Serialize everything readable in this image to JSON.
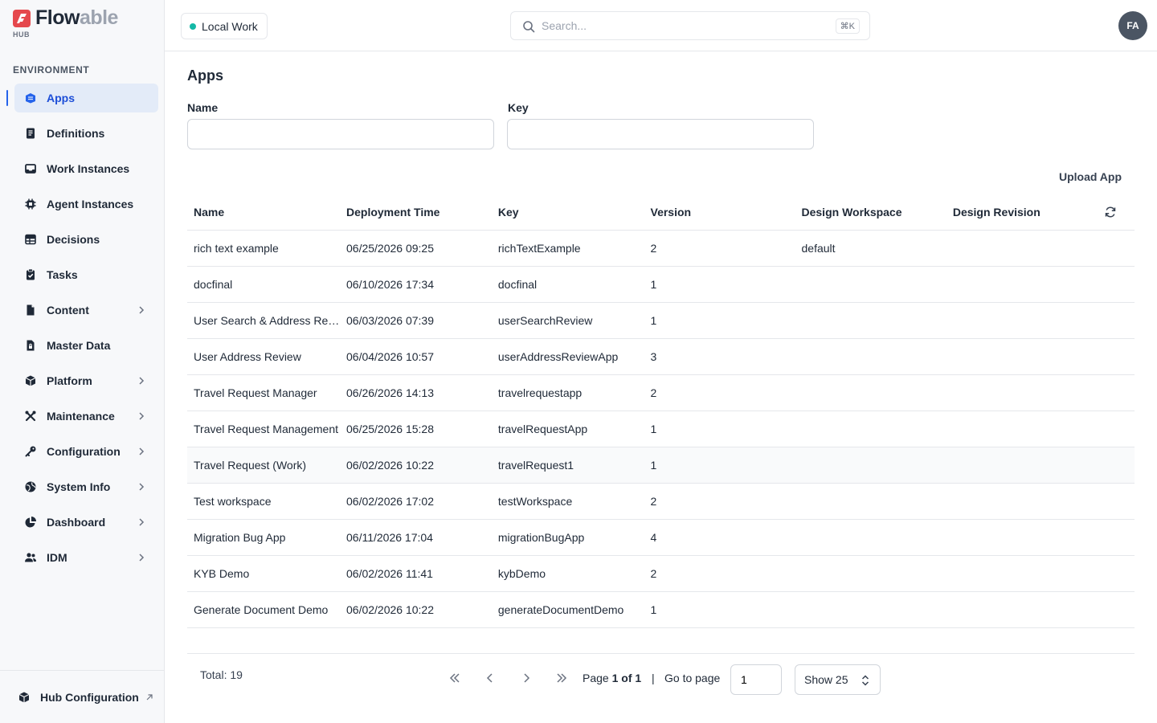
{
  "brand": {
    "name_part1": "Flow",
    "name_part2": "able",
    "sub": "HUB"
  },
  "sidebar": {
    "section_label": "ENVIRONMENT",
    "items": [
      {
        "label": "Apps",
        "icon": "apps-icon",
        "active": true,
        "chevron": false
      },
      {
        "label": "Definitions",
        "icon": "book-icon",
        "chevron": false
      },
      {
        "label": "Work Instances",
        "icon": "inbox-icon",
        "chevron": false
      },
      {
        "label": "Agent Instances",
        "icon": "chip-icon",
        "chevron": false
      },
      {
        "label": "Decisions",
        "icon": "table-icon",
        "chevron": false
      },
      {
        "label": "Tasks",
        "icon": "clipboard-check-icon",
        "chevron": false
      },
      {
        "label": "Content",
        "icon": "file-icon",
        "chevron": true
      },
      {
        "label": "Master Data",
        "icon": "file-lock-icon",
        "chevron": false
      },
      {
        "label": "Platform",
        "icon": "cube-icon",
        "chevron": true
      },
      {
        "label": "Maintenance",
        "icon": "tools-icon",
        "chevron": true
      },
      {
        "label": "Configuration",
        "icon": "key-icon",
        "chevron": true
      },
      {
        "label": "System Info",
        "icon": "globe-icon",
        "chevron": true
      },
      {
        "label": "Dashboard",
        "icon": "pie-chart-icon",
        "chevron": true
      },
      {
        "label": "IDM",
        "icon": "users-icon",
        "chevron": true
      }
    ],
    "footer_label": "Hub Configuration"
  },
  "topbar": {
    "workspace_label": "Local Work",
    "search_placeholder": "Search...",
    "search_shortcut": "⌘K",
    "avatar_initials": "FA"
  },
  "main": {
    "title": "Apps",
    "filters": {
      "name_label": "Name",
      "name_value": "",
      "key_label": "Key",
      "key_value": ""
    },
    "upload_label": "Upload App",
    "table": {
      "columns": [
        "Name",
        "Deployment Time",
        "Key",
        "Version",
        "Design Workspace",
        "Design Revision"
      ],
      "rows": [
        [
          "rich text example",
          "06/25/2026 09:25",
          "richTextExample",
          "2",
          "default",
          ""
        ],
        [
          "docfinal",
          "06/10/2026 17:34",
          "docfinal",
          "1",
          "",
          ""
        ],
        [
          "User Search & Address Review",
          "06/03/2026 07:39",
          "userSearchReview",
          "1",
          "",
          ""
        ],
        [
          "User Address Review",
          "06/04/2026 10:57",
          "userAddressReviewApp",
          "3",
          "",
          ""
        ],
        [
          "Travel Request Manager",
          "06/26/2026 14:13",
          "travelrequestapp",
          "2",
          "",
          ""
        ],
        [
          "Travel Request Management",
          "06/25/2026 15:28",
          "travelRequestApp",
          "1",
          "",
          ""
        ],
        [
          "Travel Request (Work)",
          "06/02/2026 10:22",
          "travelRequest1",
          "1",
          "",
          ""
        ],
        [
          "Test workspace",
          "06/02/2026 17:02",
          "testWorkspace",
          "2",
          "",
          ""
        ],
        [
          "Migration Bug App",
          "06/11/2026 17:04",
          "migrationBugApp",
          "4",
          "",
          ""
        ],
        [
          "KYB Demo",
          "06/02/2026 11:41",
          "kybDemo",
          "2",
          "",
          ""
        ],
        [
          "Generate Document Demo",
          "06/02/2026 10:22",
          "generateDocumentDemo",
          "1",
          "",
          ""
        ]
      ],
      "hover_row": 6
    },
    "pager": {
      "total_text": "Total: 19",
      "page_prefix": "Page ",
      "page_current": "1 of 1",
      "separator": "|",
      "goto_label": "Go to page",
      "goto_value": "1",
      "show_label": "Show 25"
    }
  },
  "colors": {
    "accent": "#2563eb",
    "active_bg": "#e3ebf8",
    "status_dot": "#14b8a6",
    "brand_red": "#e5484d"
  }
}
